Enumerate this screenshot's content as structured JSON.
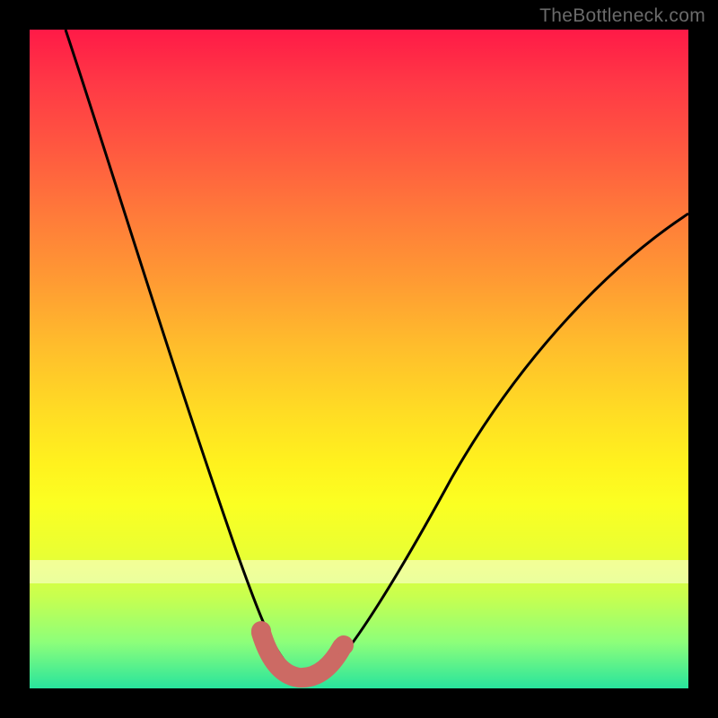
{
  "watermark": {
    "text": "TheBottleneck.com"
  },
  "chart_data": {
    "type": "line",
    "title": "",
    "xlabel": "",
    "ylabel": "",
    "xlim": [
      0,
      100
    ],
    "ylim": [
      0,
      100
    ],
    "grid": false,
    "legend": false,
    "description": "V-shaped bottleneck curve over a rainbow gradient (red top to green bottom). The black curve descends from upper-left, reaches a minimum near x≈40% at the bottom (green), then ascends toward the right edge. A short pink/salmon segment marks the bottom of the V (the sweet spot).",
    "series": [
      {
        "name": "bottleneck-curve",
        "color": "#000000",
        "x": [
          6,
          10,
          14,
          18,
          22,
          26,
          30,
          34,
          36,
          38,
          40,
          42,
          44,
          46,
          50,
          55,
          60,
          65,
          70,
          75,
          80,
          85,
          90,
          95,
          100
        ],
        "y": [
          100,
          86,
          73,
          61,
          49,
          38,
          27,
          17,
          12,
          7,
          3,
          2,
          2,
          4,
          9,
          16,
          23,
          30,
          36,
          42,
          48,
          54,
          60,
          65,
          70
        ]
      },
      {
        "name": "sweet-spot-marker",
        "color": "#cc6a64",
        "x": [
          36,
          38,
          40,
          42,
          44,
          46
        ],
        "y": [
          8,
          3,
          1,
          1,
          1,
          4
        ]
      }
    ],
    "gradient_stops": [
      {
        "pos": 0,
        "color": "#ff1a47"
      },
      {
        "pos": 18,
        "color": "#ff5840"
      },
      {
        "pos": 38,
        "color": "#ff9a33"
      },
      {
        "pos": 58,
        "color": "#ffdc24"
      },
      {
        "pos": 72,
        "color": "#fbff22"
      },
      {
        "pos": 86,
        "color": "#c8ff4f"
      },
      {
        "pos": 100,
        "color": "#28e49d"
      }
    ]
  }
}
